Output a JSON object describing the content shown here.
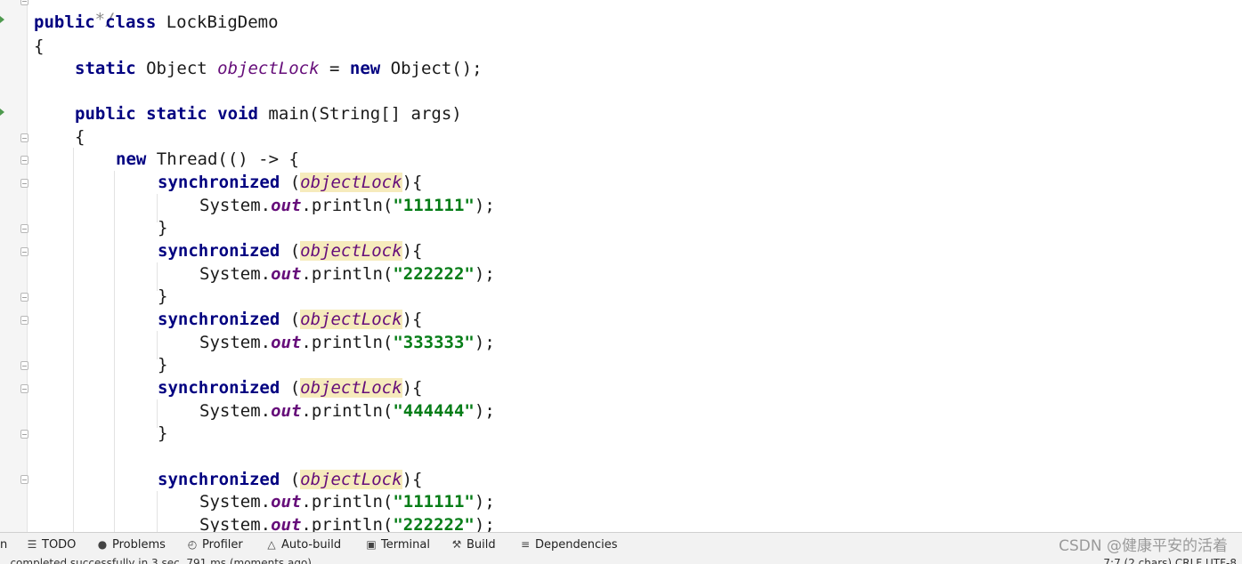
{
  "editor": {
    "comment_tail": "*/",
    "lines": {
      "l1": [
        "public",
        " ",
        "class",
        " LockBigDemo"
      ],
      "l2": "{",
      "l3": [
        "static",
        " Object ",
        "objectLock",
        " = ",
        "new",
        " Object();"
      ],
      "l4": [
        "public",
        " ",
        "static",
        " ",
        "void",
        " main(String[] args)"
      ],
      "l5": "{",
      "l6": [
        "new",
        " Thread(() -> {"
      ],
      "sync_keyword": "synchronized",
      "sync_open": " (",
      "sync_close": "){",
      "field_name": "objectLock",
      "print_prefix": "System.",
      "print_out": "out",
      "print_mid": ".println(",
      "print_end": ");",
      "close_brace": "}",
      "strings": [
        "\"111111\"",
        "\"222222\"",
        "\"333333\"",
        "\"444444\"",
        "\"111111\"",
        "\"222222\""
      ]
    }
  },
  "tool_windows": [
    {
      "icon": "list-icon",
      "glyph": "☰",
      "label": "TODO"
    },
    {
      "icon": "problems-icon",
      "glyph": "●",
      "label": "Problems"
    },
    {
      "icon": "profiler-icon",
      "glyph": "◴",
      "label": "Profiler"
    },
    {
      "icon": "warning-icon",
      "glyph": "△",
      "label": "Auto-build"
    },
    {
      "icon": "terminal-icon",
      "glyph": "▣",
      "label": "Terminal"
    },
    {
      "icon": "hammer-icon",
      "glyph": "⚒",
      "label": "Build"
    },
    {
      "icon": "layers-icon",
      "glyph": "≡",
      "label": "Dependencies"
    }
  ],
  "tool_window_left_fragment": "n",
  "watermark": "CSDN @健康平安的活着",
  "status": {
    "left": "...completed successfully in 3 sec, 791 ms (moments ago)",
    "right": "7:7 (2 chars)   CRLF   UTF-8"
  },
  "colors": {
    "keyword": "#000080",
    "field": "#660e7a",
    "string": "#067d17",
    "field_highlight": "#f6ebbc"
  }
}
